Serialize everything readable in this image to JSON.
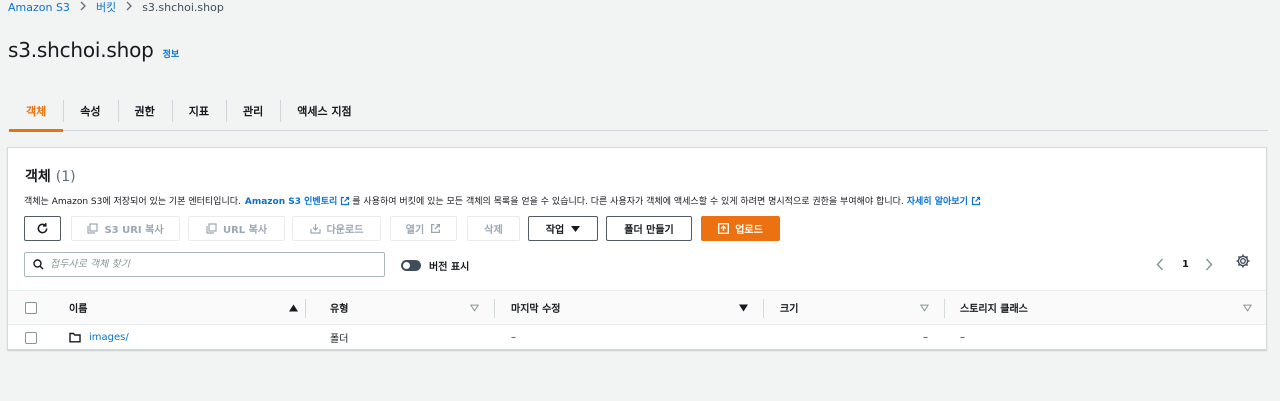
{
  "breadcrumb": {
    "items": [
      "Amazon S3",
      "버킷"
    ],
    "current": "s3.shchoi.shop",
    "separator": ">"
  },
  "page": {
    "title": "s3.shchoi.shop",
    "info_link": "정보"
  },
  "tabs": [
    {
      "label": "객체",
      "active": true
    },
    {
      "label": "속성",
      "active": false
    },
    {
      "label": "권한",
      "active": false
    },
    {
      "label": "지표",
      "active": false
    },
    {
      "label": "관리",
      "active": false
    },
    {
      "label": "액세스 지점",
      "active": false
    }
  ],
  "panel": {
    "title": "객체",
    "count": "(1)",
    "description": {
      "part1": "객체는 Amazon S3에 저장되어 있는 기본 엔터티입니다.",
      "link1": "Amazon S3 인벤토리",
      "part2": "를 사용하여 버킷에 있는 모든 객체의 목록을 얻을 수 있습니다. 다른 사용자가 객체에 액세스할 수 있게 하려면 명시적으로 권한을 부여해야 합니다.",
      "link2": "자세히 알아보기"
    }
  },
  "toolbar": {
    "copy_s3_uri": "S3 URI 복사",
    "copy_url": "URL 복사",
    "download": "다운로드",
    "open": "열기",
    "delete": "삭제",
    "actions": "작업",
    "create_folder": "폴더 만들기",
    "upload": "업로드"
  },
  "search": {
    "placeholder": "접두사로 객체 찾기",
    "value": ""
  },
  "version_toggle": {
    "label": "버전 표시",
    "on": false
  },
  "pagination": {
    "page": "1"
  },
  "table": {
    "columns": [
      "이름",
      "유형",
      "마지막 수정",
      "크기",
      "스토리지 클래스"
    ],
    "rows": [
      {
        "name": "images/",
        "type": "폴더",
        "last_modified": "–",
        "size": "–",
        "storage_class": "–"
      }
    ]
  },
  "colors": {
    "accent": "#ec7211",
    "link": "#0972d3",
    "text": "#16191f",
    "background": "#f2f3f3"
  },
  "icons": [
    "chevron-right-icon",
    "refresh-icon",
    "copy-icon",
    "download-icon",
    "external-link-icon",
    "caret-down-icon",
    "upload-icon",
    "search-icon",
    "chevron-left-icon",
    "gear-icon",
    "folder-icon",
    "sort-asc-icon",
    "sort-desc-icon"
  ]
}
